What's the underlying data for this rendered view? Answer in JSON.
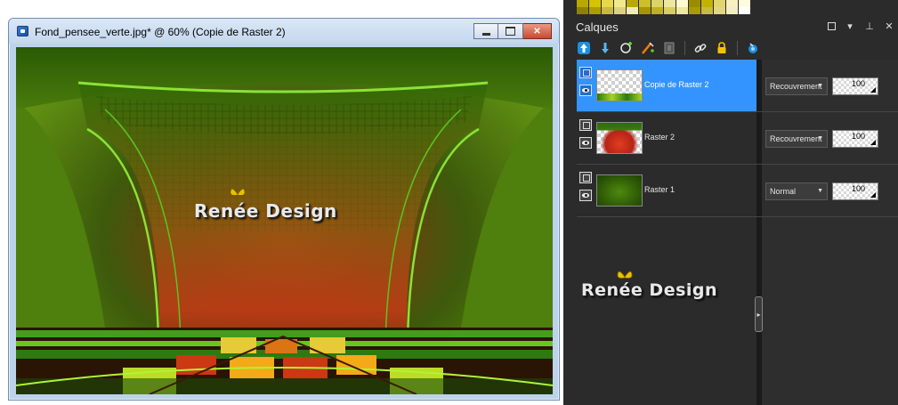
{
  "image_window": {
    "title": "Fond_pensee_verte.jpg* @  60% (Copie de Raster 2)",
    "watermark": "Renée Design"
  },
  "palette": {
    "row1": [
      "#b9a800",
      "#d4c400",
      "#e6d84a",
      "#f1e98c",
      "#b9a800",
      "#cbbf2a",
      "#ddd36b",
      "#ede6a1",
      "#fffad0",
      "#9a8c00",
      "#c3b300",
      "#e0d56e",
      "#f7f1c0",
      "#fffbe0"
    ],
    "row2": [
      "#8f8200",
      "#ad9e00",
      "#c7ba3a",
      "#ddd27c",
      "#f0ebb8",
      "#a59700",
      "#bfb122",
      "#d8cd62",
      "#eee7a6",
      "#a99c00",
      "#c8bb3e",
      "#e0d781",
      "#f3eec4",
      "#ffffff"
    ]
  },
  "layers_panel": {
    "title": "Calques",
    "watermark": "Renée Design",
    "layers": [
      {
        "name": "Copie de Raster 2",
        "blend_mode": "Recouvrement",
        "opacity": "100",
        "selected": true
      },
      {
        "name": "Raster 2",
        "blend_mode": "Recouvrement",
        "opacity": "100",
        "selected": false
      },
      {
        "name": "Raster 1",
        "blend_mode": "Normal",
        "opacity": "100",
        "selected": false
      }
    ]
  },
  "colors": {
    "selection": "#3394ff",
    "panel_bg": "#2b2b2b",
    "accent_green": "#6a9b18",
    "accent_red": "#c0441a"
  }
}
